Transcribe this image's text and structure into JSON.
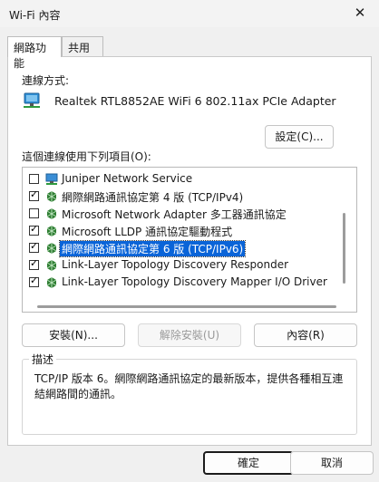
{
  "window": {
    "title": "Wi-Fi 內容"
  },
  "tabs": [
    {
      "label": "網路功能",
      "active": true
    },
    {
      "label": "共用",
      "active": false
    }
  ],
  "connect_using": {
    "label": "連線方式:",
    "adapter": "Realtek RTL8852AE WiFi 6 802.11ax PCIe Adapter",
    "adapter_icon": "network-adapter-icon"
  },
  "configure_button": "設定(C)...",
  "items_label": "這個連線使用下列項目(O):",
  "items": [
    {
      "label": "Juniper Network Service",
      "checked": false,
      "selected": false,
      "icon": "network-service-icon"
    },
    {
      "label": "網際網路通訊協定第 4 版 (TCP/IPv4)",
      "checked": true,
      "selected": false,
      "icon": "protocol-icon"
    },
    {
      "label": "Microsoft Network Adapter 多工器通訊協定",
      "checked": false,
      "selected": false,
      "icon": "protocol-icon"
    },
    {
      "label": "Microsoft LLDP 通訊協定驅動程式",
      "checked": true,
      "selected": false,
      "icon": "protocol-icon"
    },
    {
      "label": "網際網路通訊協定第 6 版 (TCP/IPv6)",
      "checked": true,
      "selected": true,
      "icon": "protocol-icon"
    },
    {
      "label": "Link-Layer Topology Discovery Responder",
      "checked": true,
      "selected": false,
      "icon": "protocol-icon"
    },
    {
      "label": "Link-Layer Topology Discovery Mapper I/O Driver",
      "checked": true,
      "selected": false,
      "icon": "protocol-icon"
    }
  ],
  "actions": {
    "install": "安裝(N)...",
    "uninstall": "解除安裝(U)",
    "properties": "內容(R)"
  },
  "description": {
    "title": "描述",
    "text": "TCP/IP 版本 6。網際網路通訊協定的最新版本，提供各種相互連結網路間的通訊。"
  },
  "footer": {
    "ok": "確定",
    "cancel": "取消"
  },
  "colors": {
    "selection": "#0a64d8",
    "protocol_icon": "#2e7d32"
  }
}
